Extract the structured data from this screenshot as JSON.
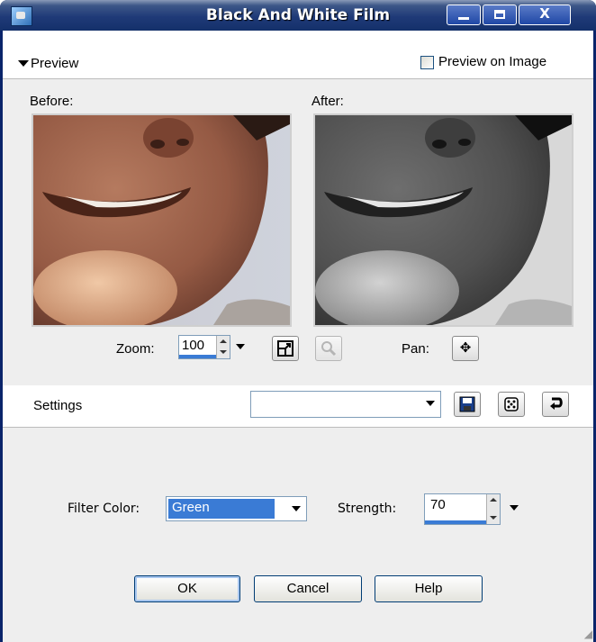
{
  "window": {
    "title": "Black And White Film",
    "controls": [
      "_",
      "□",
      "X"
    ]
  },
  "preview": {
    "toggle_label": "Preview",
    "preview_on_image_label": "Preview on Image",
    "preview_on_image_checked": false,
    "before_label": "Before:",
    "after_label": "After:"
  },
  "zoom": {
    "label": "Zoom:",
    "value": "100"
  },
  "pan": {
    "label": "Pan:",
    "icon": "✥"
  },
  "settings": {
    "label": "Settings",
    "preset_value": ""
  },
  "filter": {
    "color_label": "Filter Color:",
    "color_value": "Green",
    "strength_label": "Strength:",
    "strength_value": "70"
  },
  "buttons": {
    "ok": "OK",
    "cancel": "Cancel",
    "help": "Help"
  }
}
